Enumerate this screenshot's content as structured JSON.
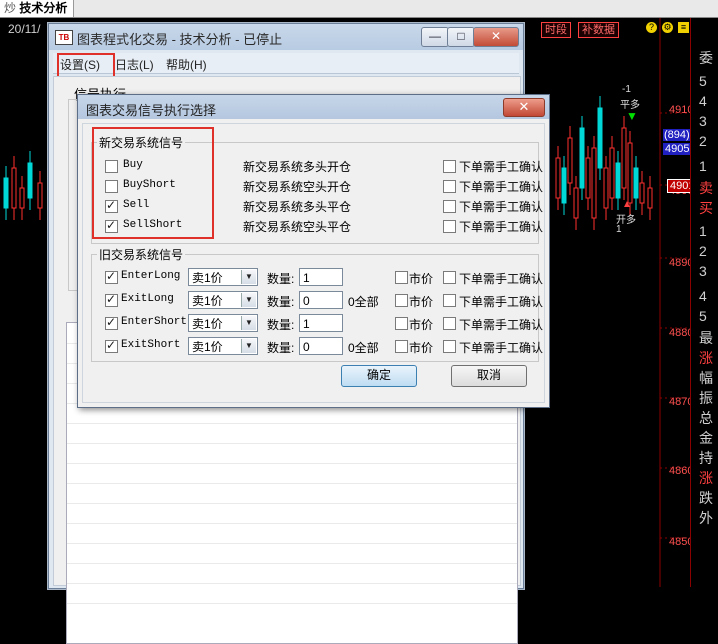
{
  "top_tab": {
    "prefix": "炒",
    "label": "技术分析"
  },
  "chart": {
    "date_label": "20/11/",
    "shiduan_button": "时段",
    "buyuan_button": "补数据",
    "price_ticks": [
      "4910",
      "4900",
      "4890",
      "4880",
      "4870",
      "4860",
      "4850"
    ],
    "badge_894": "(894)",
    "badge_4905": "4905",
    "badge_4901": "4901",
    "marker_top": "-1",
    "marker_top_label": "平多",
    "marker_bottom_label": "开多",
    "marker_bottom_value": "1",
    "right_panel_chars": [
      "委",
      "5",
      "4",
      "3",
      "2",
      "1",
      "卖",
      "买",
      "1",
      "2",
      "3",
      "4",
      "5",
      "最",
      "涨",
      "幅",
      "振",
      "总",
      "金",
      "持",
      "涨",
      "跌",
      "外"
    ],
    "colors": {
      "up": "#ff3030",
      "down": "#00d8d8",
      "grid": "#8b0000"
    }
  },
  "main_window": {
    "title": "图表程式化交易 - 技术分析 - 已停止",
    "app_icon": "TB",
    "controls": {
      "minimize": "—",
      "maximize": "□",
      "close": "✕"
    },
    "menu": {
      "settings": "设置(S)",
      "log": "日志(L)",
      "help": "帮助(H)"
    },
    "signal_exec_label": "信号执行"
  },
  "dialog": {
    "title": "图表交易信号执行选择",
    "close": "✕",
    "new_group_title": "新交易系统信号",
    "new_signals": [
      {
        "name": "Buy",
        "checked": false,
        "desc": "新交易系统多头开仓",
        "confirm": "下单需手工确认"
      },
      {
        "name": "BuyShort",
        "checked": false,
        "desc": "新交易系统空头开仓",
        "confirm": "下单需手工确认"
      },
      {
        "name": "Sell",
        "checked": true,
        "desc": "新交易系统多头平仓",
        "confirm": "下单需手工确认"
      },
      {
        "name": "SellShort",
        "checked": true,
        "desc": "新交易系统空头平仓",
        "confirm": "下单需手工确认"
      }
    ],
    "old_group_title": "旧交易系统信号",
    "old_signals": [
      {
        "name": "EnterLong",
        "checked": true,
        "price": "卖1价",
        "qty_label": "数量:",
        "qty": "1",
        "all": "",
        "market": "市价",
        "confirm": "下单需手工确认"
      },
      {
        "name": "ExitLong",
        "checked": true,
        "price": "卖1价",
        "qty_label": "数量:",
        "qty": "0",
        "all": "0全部",
        "market": "市价",
        "confirm": "下单需手工确认"
      },
      {
        "name": "EnterShort",
        "checked": true,
        "price": "卖1价",
        "qty_label": "数量:",
        "qty": "1",
        "all": "",
        "market": "市价",
        "confirm": "下单需手工确认"
      },
      {
        "name": "ExitShort",
        "checked": true,
        "price": "卖1价",
        "qty_label": "数量:",
        "qty": "0",
        "all": "0全部",
        "market": "市价",
        "confirm": "下单需手工确认"
      }
    ],
    "ok_button": "确定",
    "cancel_button": "取消"
  }
}
